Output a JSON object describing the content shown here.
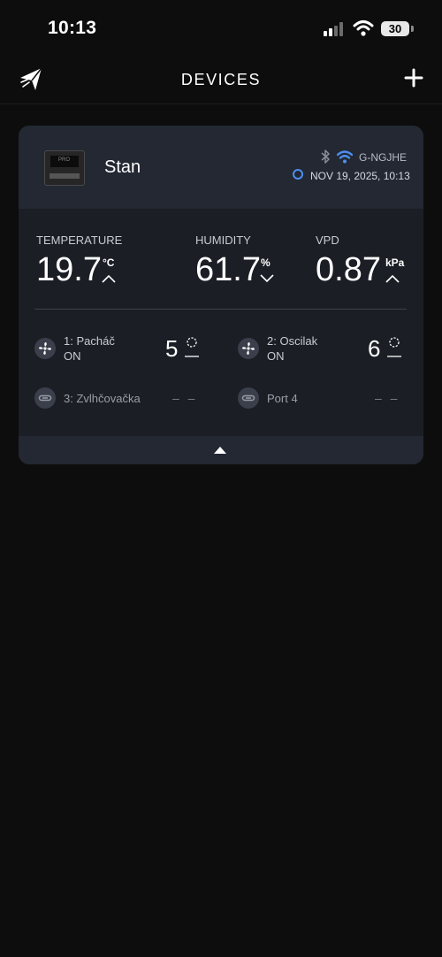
{
  "status_bar": {
    "time": "10:13",
    "battery": "30"
  },
  "header": {
    "title": "DEVICES",
    "logo_icon": "logo-icon",
    "add_icon": "plus-icon"
  },
  "device": {
    "name": "Stan",
    "thumbnail_label": "PRO",
    "wifi_name": "G-NGJHE",
    "timestamp": "NOV 19, 2025, 10:13",
    "metrics": [
      {
        "label": "TEMPERATURE",
        "value": "19.7",
        "unit": "°C",
        "trend": "up"
      },
      {
        "label": "HUMIDITY",
        "value": "61.7",
        "unit": "%",
        "trend": "down"
      },
      {
        "label": "VPD",
        "value": "0.87",
        "unit": "kPa",
        "trend": "up"
      }
    ],
    "ports": [
      {
        "name": "1: Pacháč",
        "state": "ON",
        "level": "5",
        "icon": "fan-icon"
      },
      {
        "name": "2: Oscilak",
        "state": "ON",
        "level": "6",
        "icon": "fan-icon"
      },
      {
        "name": "3: Zvlhčovačka",
        "level": "– –",
        "icon": "link-icon"
      },
      {
        "name": "Port 4",
        "level": "– –",
        "icon": "link-icon"
      }
    ]
  },
  "colors": {
    "background": "#0d0d0e",
    "card": "#1b1e25",
    "card_header": "#232833",
    "accent": "#4d8ff0"
  }
}
